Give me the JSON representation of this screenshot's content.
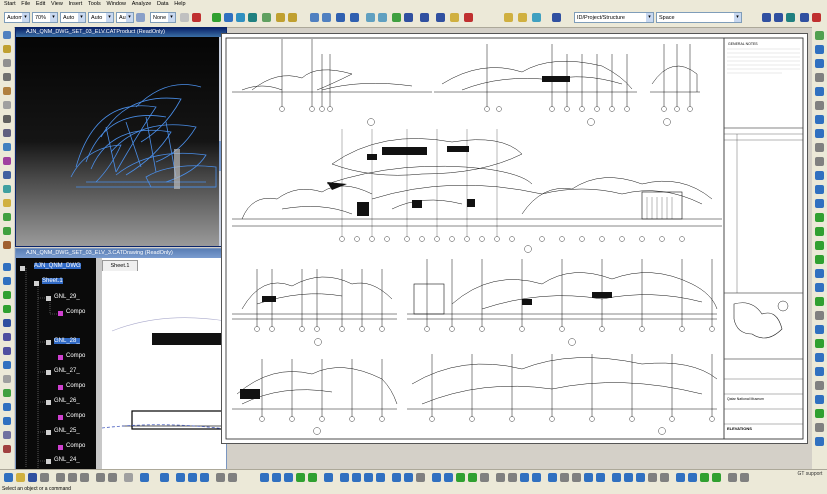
{
  "menu": [
    "Start",
    "File",
    "Edit",
    "View",
    "Insert",
    "Tools",
    "Window",
    "Analyze",
    "Data",
    "Help"
  ],
  "toolbar": {
    "zoom_mode": "Automa",
    "zoom_percent": "70%",
    "line_auto": "Auto",
    "weight_auto": "Auto",
    "style_auto": "Aut",
    "none_value": "None",
    "path_field": "ID/Project/Structure",
    "space_field": "Space"
  },
  "window1": {
    "title": "AJN_QNM_DWG_SET_03_ELV.CATProduct (ReadOnly)"
  },
  "window2": {
    "title": "AJN_QNM_DWG_SET_03_ELV_3.CATDrawing (ReadOnly)",
    "tab": "Sheet.1",
    "tree": [
      "AJN_QNM_DWG",
      "Sheet.1",
      "GNL_29_",
      "Compo",
      "GNL_28_",
      "Compo",
      "GNL_27_",
      "Compo",
      "GNL_26_",
      "Compo",
      "GNL_25_",
      "Compo",
      "GNL_24_"
    ]
  },
  "status": {
    "message": "Select an object or a command"
  },
  "right_logo": "GT support",
  "title_block": {
    "general_notes": "GENERAL NOTES",
    "project": "Qatar National Museum",
    "sheet_name": "ELEVATIONS"
  }
}
